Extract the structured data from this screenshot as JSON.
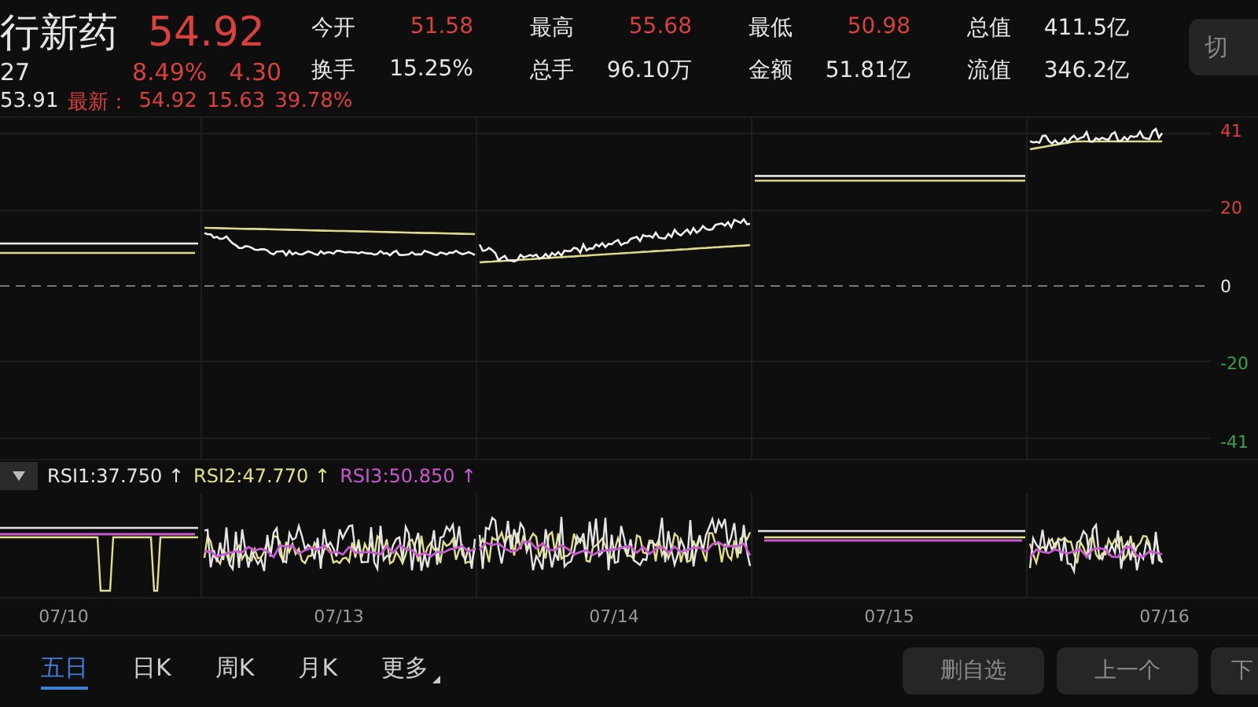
{
  "stock": {
    "name": "行新药",
    "code": "27",
    "price": "54.92",
    "change_pct": "8.49%",
    "change": "4.30"
  },
  "stats": [
    {
      "label": "今开",
      "value": "51.58",
      "color": "#d8413c"
    },
    {
      "label": "最高",
      "value": "55.68",
      "color": "#d8413c"
    },
    {
      "label": "最低",
      "value": "50.98",
      "color": "#d8413c"
    },
    {
      "label": "总值",
      "value": "411.5亿",
      "color": "#e6e6e6"
    },
    {
      "label": "换手",
      "value": "15.25%",
      "color": "#e6e6e6"
    },
    {
      "label": "总手",
      "value": "96.10万",
      "color": "#e6e6e6"
    },
    {
      "label": "金额",
      "value": "51.81亿",
      "color": "#e6e6e6"
    },
    {
      "label": "流值",
      "value": "346.2亿",
      "color": "#e6e6e6"
    }
  ],
  "switch_button": "切",
  "info_line": {
    "prev": "53.91",
    "latest_label": "最新：",
    "latest": "54.92",
    "diff": "15.63",
    "pct": "39.78%"
  },
  "price_axis": [
    {
      "label": "41",
      "color": "#d8413c"
    },
    {
      "label": "20",
      "color": "#d8413c"
    },
    {
      "label": "0",
      "color": "#e6e6e6"
    },
    {
      "label": "-20",
      "color": "#3aa24a"
    },
    {
      "label": "-41",
      "color": "#3aa24a"
    }
  ],
  "indicator": {
    "readings": [
      {
        "text": "RSI1:37.750 ↑",
        "color": "#e6e6e6"
      },
      {
        "text": "RSI2:47.770 ↑",
        "color": "#e4e08a"
      },
      {
        "text": "RSI3:50.850 ↑",
        "color": "#c85ad0"
      }
    ]
  },
  "dates": [
    "07/10",
    "07/13",
    "07/14",
    "07/15",
    "07/16"
  ],
  "period_tabs": [
    {
      "label": "五日",
      "selected": true
    },
    {
      "label": "日K",
      "selected": false
    },
    {
      "label": "周K",
      "selected": false
    },
    {
      "label": "月K",
      "selected": false
    },
    {
      "label": "更多",
      "selected": false,
      "menu": true
    }
  ],
  "buttons": [
    "删自选",
    "上一个",
    "下"
  ]
}
